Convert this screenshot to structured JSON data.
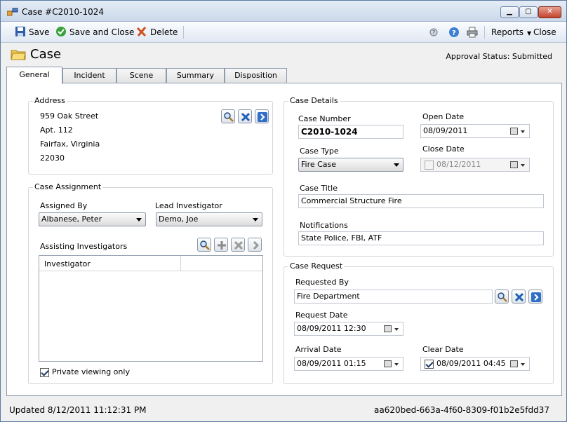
{
  "window": {
    "title": "Case #C2010-1024"
  },
  "toolbar": {
    "save": "Save",
    "save_close": "Save and Close",
    "delete": "Delete",
    "reports": "Reports",
    "close": "Close"
  },
  "header": {
    "title": "Case",
    "approval": "Approval Status: Submitted"
  },
  "tabs": [
    "General",
    "Incident",
    "Scene",
    "Summary",
    "Disposition"
  ],
  "address": {
    "title": "Address",
    "lines": [
      "959 Oak Street",
      "Apt. 112",
      "Fairfax, Virginia",
      "22030"
    ]
  },
  "assignment": {
    "title": "Case Assignment",
    "assigned_by_label": "Assigned By",
    "assigned_by": "Albanese, Peter",
    "lead_label": "Lead Investigator",
    "lead": "Demo, Joe",
    "assisting_label": "Assisting Investigators",
    "column": "Investigator",
    "private_label": "Private viewing only"
  },
  "details": {
    "title": "Case Details",
    "number_label": "Case Number",
    "number": "C2010-1024",
    "open_label": "Open Date",
    "open_date": "08/09/2011",
    "type_label": "Case Type",
    "type": "Fire Case",
    "close_label": "Close Date",
    "close_date": "08/12/2011",
    "title_label": "Case Title",
    "case_title": "Commercial Structure Fire",
    "notif_label": "Notifications",
    "notifications": "State Police, FBI, ATF"
  },
  "request": {
    "title": "Case Request",
    "requested_by_label": "Requested By",
    "requested_by": "Fire Department",
    "request_date_label": "Request Date",
    "request_date": "08/09/2011 12:30",
    "arrival_label": "Arrival Date",
    "arrival_date": "08/09/2011 01:15",
    "clear_label": "Clear Date",
    "clear_date": "08/09/2011 04:45"
  },
  "status": {
    "updated": "Updated 8/12/2011 11:12:31 PM",
    "guid": "aa620bed-663a-4f60-8309-f01b2e5fdd37"
  }
}
